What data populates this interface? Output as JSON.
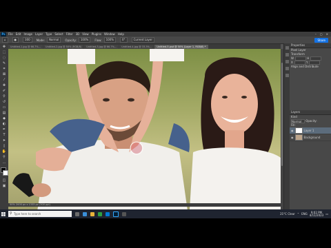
{
  "menubar": {
    "logo": "Ps",
    "items": [
      "File",
      "Edit",
      "Image",
      "Layer",
      "Type",
      "Select",
      "Filter",
      "3D",
      "View",
      "Plugins",
      "Window",
      "Help"
    ],
    "win_controls": [
      "–",
      "▢",
      "✕"
    ]
  },
  "options": {
    "size": "300",
    "mode_label": "Mode:",
    "mode": "Normal",
    "opacity_label": "Opacity:",
    "opacity": "100%",
    "flow_label": "Flow:",
    "flow": "100%",
    "angle": "0°",
    "sample": "Current Layer",
    "share": "Share"
  },
  "tabs": [
    {
      "label": "Untitled-1.jpg @ 66.7%...",
      "active": false
    },
    {
      "label": "Untitled-2.jpg @ 50% (RGB/8)",
      "active": false
    },
    {
      "label": "Untitled-3.jpg @ 66.7%...",
      "active": false
    },
    {
      "label": "Untitled-4.jpg @ 33.3%...",
      "active": false
    },
    {
      "label": "Untitled-5.psd @ 50% (Layer 1, RGB/8) *",
      "active": true
    }
  ],
  "status": "50%     2000 px x 1333 px (300 ppi)",
  "panels": {
    "properties_title": "Properties",
    "layer_label": "Pixel Layer",
    "transform_label": "Transform",
    "w_label": "W",
    "h_label": "H",
    "x_label": "X",
    "y_label": "Y",
    "align_label": "Align and Distribute",
    "layers_title": "Layers",
    "kind_label": "Kind",
    "blend": "Normal",
    "opacity_label": "Opacity:",
    "fill_label": "Fill:",
    "layers": [
      {
        "name": "Layer 1",
        "selected": true
      },
      {
        "name": "Background",
        "selected": false
      }
    ]
  },
  "taskbar": {
    "search_placeholder": "Type here to search",
    "weather": "21°C  Clear",
    "time": "9:02 PM",
    "date": "4/11/2023",
    "lang": "ENG"
  },
  "colors": {
    "accent": "#1473e6",
    "ps_blue": "#31a8ff",
    "ui_dark": "#3c3c3c",
    "ui_mid": "#535353"
  }
}
